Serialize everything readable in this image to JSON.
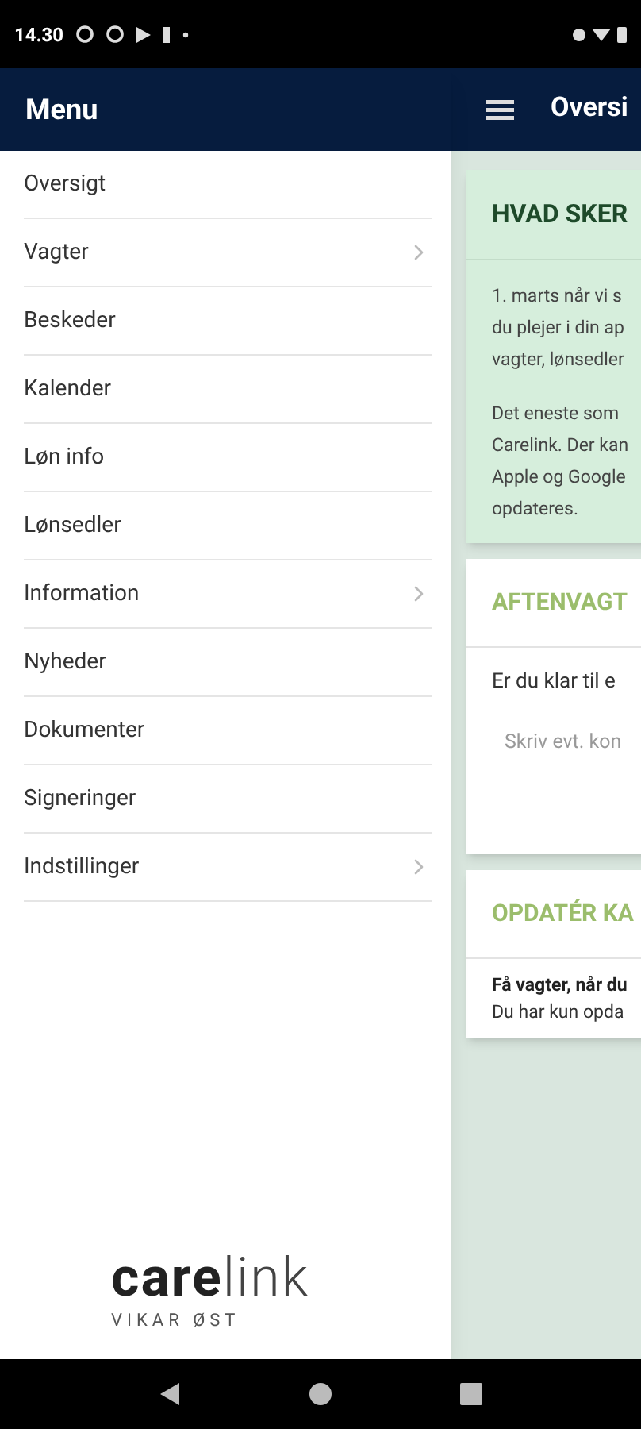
{
  "status_bar": {
    "time": "14.30"
  },
  "drawer": {
    "title": "Menu",
    "items": [
      {
        "label": "Oversigt",
        "expandable": false
      },
      {
        "label": "Vagter",
        "expandable": true
      },
      {
        "label": "Beskeder",
        "expandable": false
      },
      {
        "label": "Kalender",
        "expandable": false
      },
      {
        "label": "Løn info",
        "expandable": false
      },
      {
        "label": "Lønsedler",
        "expandable": false
      },
      {
        "label": "Information",
        "expandable": true
      },
      {
        "label": "Nyheder",
        "expandable": false
      },
      {
        "label": "Dokumenter",
        "expandable": false
      },
      {
        "label": "Signeringer",
        "expandable": false
      },
      {
        "label": "Indstillinger",
        "expandable": true
      }
    ],
    "logo": {
      "strong": "care",
      "light": "link",
      "tagline": "VIKAR ØST"
    }
  },
  "main": {
    "title": "Oversi",
    "cards": [
      {
        "kind": "notice",
        "title": "HVAD SKER",
        "paragraphs": [
          [
            "1. marts når vi s",
            "du plejer i din ap",
            "vagter, lønsedler"
          ],
          [
            "Det eneste som",
            "Carelink. Der kan",
            "Apple og Google",
            "opdateres."
          ]
        ]
      },
      {
        "kind": "question",
        "title": "AFTENVAGT",
        "question": "Er du klar til e",
        "placeholder": "Skriv evt. kon"
      },
      {
        "kind": "info",
        "title": "OPDATÉR KA",
        "lead": "Få vagter, når du",
        "text": "Du har kun opda"
      }
    ]
  }
}
